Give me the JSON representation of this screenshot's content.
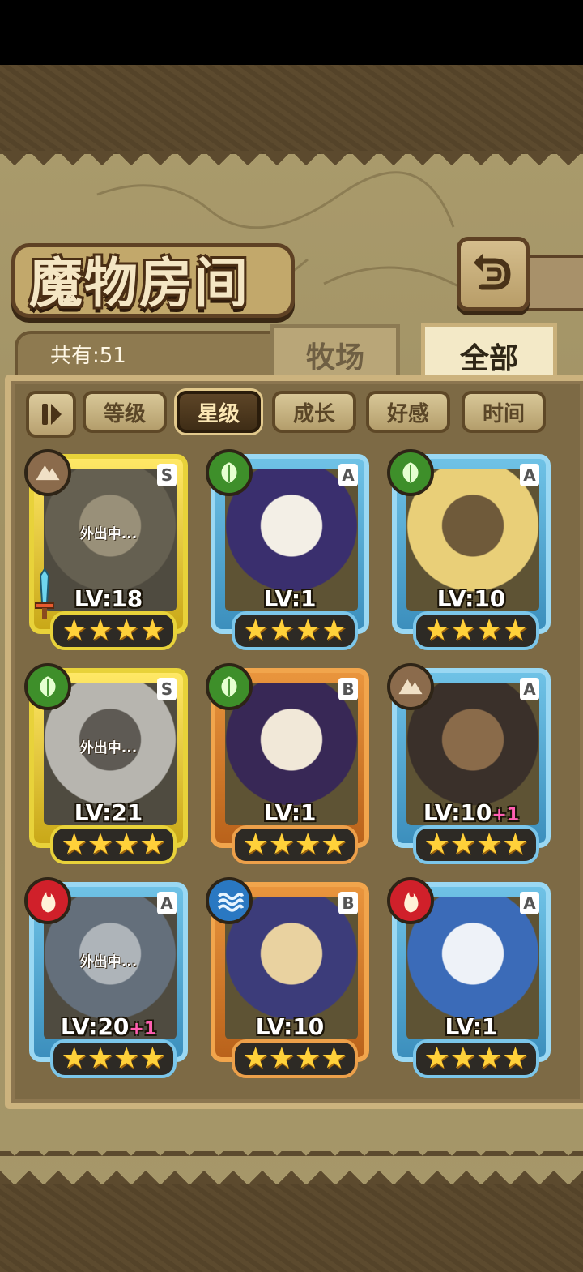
{
  "title": "魔物房间",
  "count_label": "共有:51",
  "tabs": {
    "ranch": "牧场",
    "all": "全部"
  },
  "sort_buttons": [
    "等级",
    "星级",
    "成长",
    "好感",
    "时间"
  ],
  "active_sort": "星级",
  "away_label": "外出中...",
  "cards": [
    {
      "grade": "S",
      "element": "earth",
      "level": "LV:18",
      "plus": "",
      "stars": 4,
      "frame": "gold",
      "away": true,
      "equip": "sword-icon"
    },
    {
      "grade": "A",
      "element": "leaf",
      "level": "LV:1",
      "plus": "",
      "stars": 4,
      "frame": "blue",
      "away": false
    },
    {
      "grade": "A",
      "element": "leaf",
      "level": "LV:10",
      "plus": "",
      "stars": 4,
      "frame": "blue",
      "away": false
    },
    {
      "grade": "S",
      "element": "leaf",
      "level": "LV:21",
      "plus": "",
      "stars": 4,
      "frame": "gold",
      "away": true
    },
    {
      "grade": "B",
      "element": "leaf",
      "level": "LV:1",
      "plus": "",
      "stars": 4,
      "frame": "orange",
      "away": false
    },
    {
      "grade": "A",
      "element": "earth",
      "level": "LV:10",
      "plus": "+1",
      "stars": 4,
      "frame": "blue",
      "away": false
    },
    {
      "grade": "A",
      "element": "fire",
      "level": "LV:20",
      "plus": "+1",
      "stars": 4,
      "frame": "blue",
      "away": true
    },
    {
      "grade": "B",
      "element": "water",
      "level": "LV:10",
      "plus": "",
      "stars": 4,
      "frame": "orange",
      "away": false
    },
    {
      "grade": "A",
      "element": "fire",
      "level": "LV:1",
      "plus": "",
      "stars": 4,
      "frame": "blue",
      "away": false
    }
  ],
  "colors": {
    "earth": "#8b6b4c",
    "leaf": "#3e8f2a",
    "fire": "#d0202a",
    "water": "#2a78c2"
  }
}
